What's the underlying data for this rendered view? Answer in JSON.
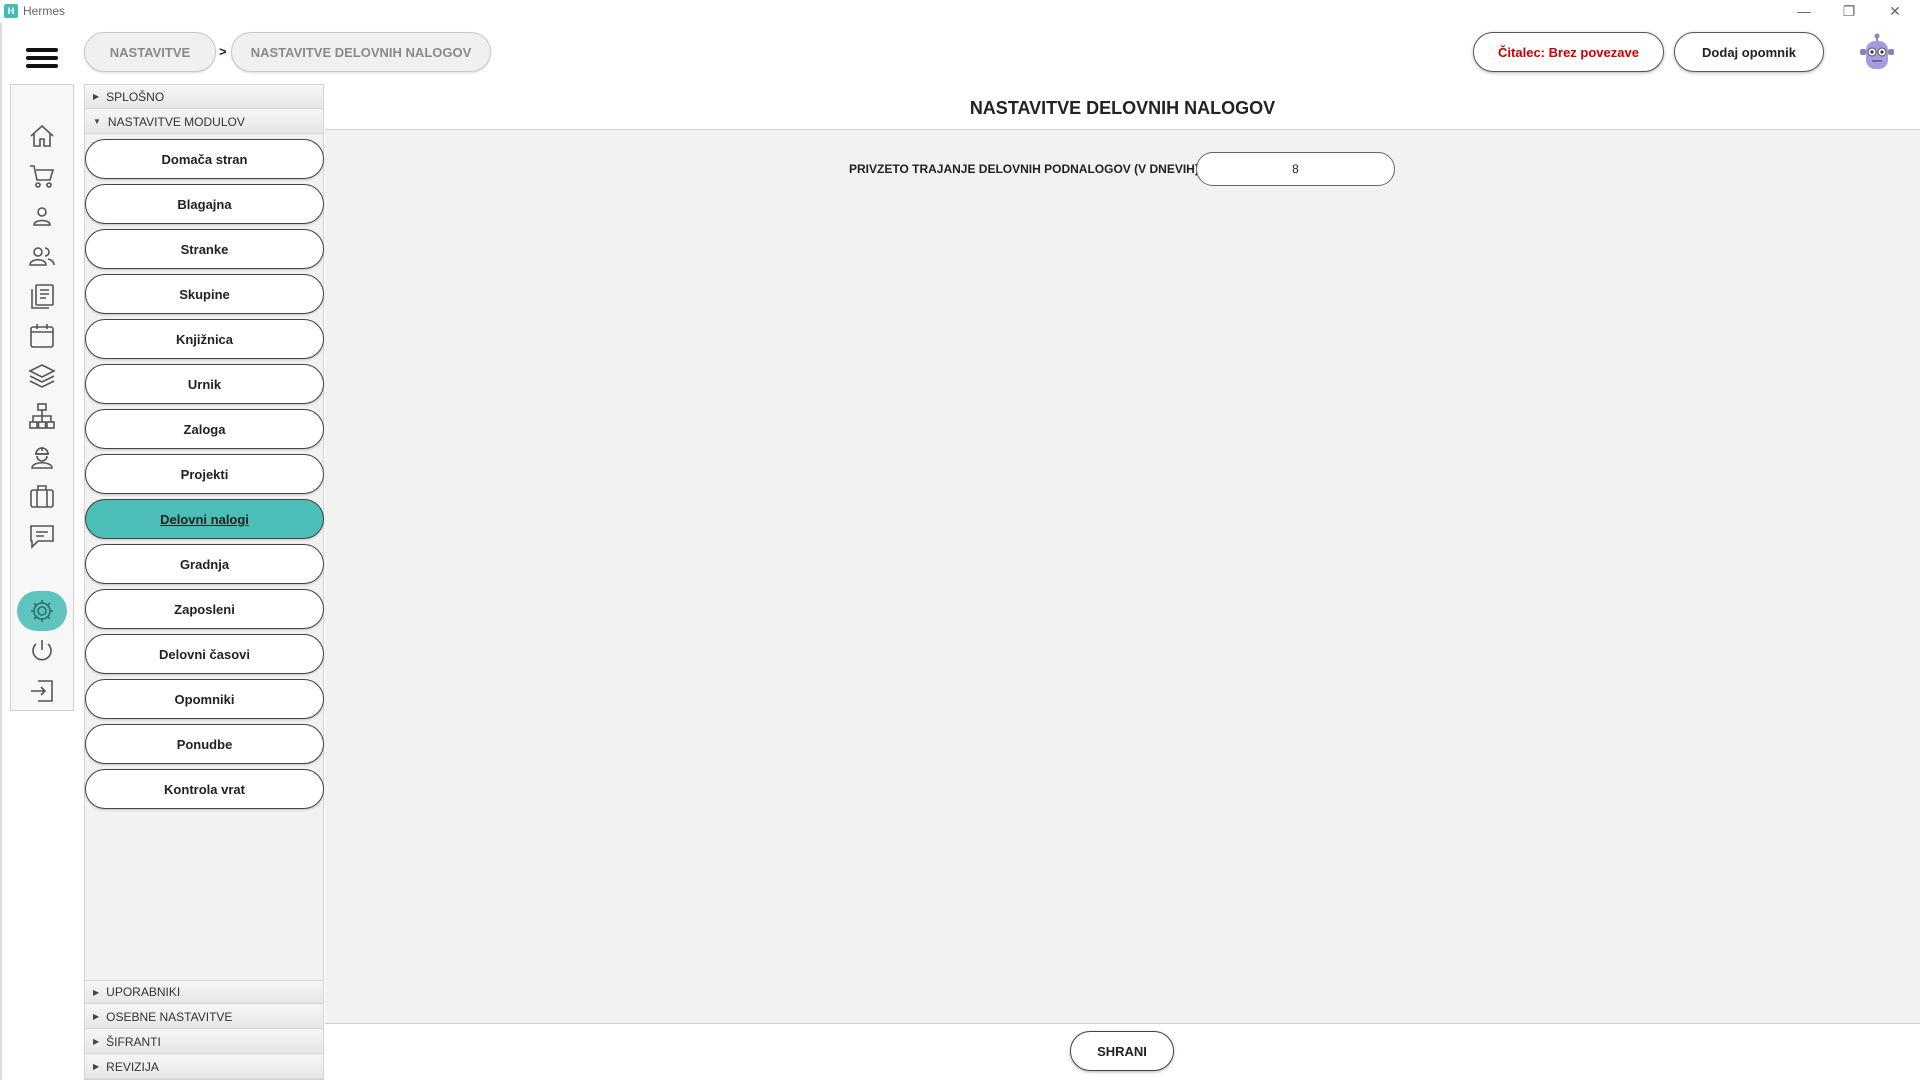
{
  "window": {
    "title": "Hermes",
    "logo_glyph": "H",
    "controls": {
      "minimize": "—",
      "maximize": "❐",
      "close": "✕"
    }
  },
  "header": {
    "breadcrumb": [
      {
        "label": "NASTAVITVE"
      },
      {
        "label": "NASTAVITVE DELOVNIH NALOGOV"
      }
    ],
    "breadcrumb_separator": ">",
    "reader_status": "Čitalec: Brez povezave",
    "add_reminder": "Dodaj opomnik"
  },
  "nav_icons": [
    "home-icon",
    "cart-icon",
    "person-icon",
    "people-icon",
    "documents-icon",
    "calendar-icon",
    "layers-icon",
    "hierarchy-icon",
    "worker-icon",
    "briefcase-icon",
    "chat-icon",
    "gear-icon",
    "power-icon",
    "logout-icon"
  ],
  "settings": {
    "sections_top": [
      {
        "label": "SPLOŠNO",
        "expanded": false
      },
      {
        "label": "NASTAVITVE MODULOV",
        "expanded": true
      }
    ],
    "modules": [
      {
        "label": "Domača stran"
      },
      {
        "label": "Blagajna"
      },
      {
        "label": "Stranke"
      },
      {
        "label": "Skupine"
      },
      {
        "label": "Knjižnica"
      },
      {
        "label": "Urnik"
      },
      {
        "label": "Zaloga"
      },
      {
        "label": "Projekti"
      },
      {
        "label": "Delovni nalogi",
        "active": true
      },
      {
        "label": "Gradnja"
      },
      {
        "label": "Zaposleni"
      },
      {
        "label": "Delovni časovi"
      },
      {
        "label": "Opomniki"
      },
      {
        "label": "Ponudbe"
      },
      {
        "label": "Kontrola vrat"
      }
    ],
    "sections_bottom": [
      {
        "label": "UPORABNIKI"
      },
      {
        "label": "OSEBNE NASTAVITVE"
      },
      {
        "label": "ŠIFRANTI"
      },
      {
        "label": "REVIZIJA"
      }
    ]
  },
  "main": {
    "title": "NASTAVITVE DELOVNIH NALOGOV",
    "field_label": "PRIVZETO TRAJANJE DELOVNIH PODNALOGOV (V DNEVIH)",
    "field_value": "8",
    "save": "SHRANI"
  },
  "colors": {
    "accent": "#4bbfb7",
    "reader_status_text": "#cc0000"
  }
}
